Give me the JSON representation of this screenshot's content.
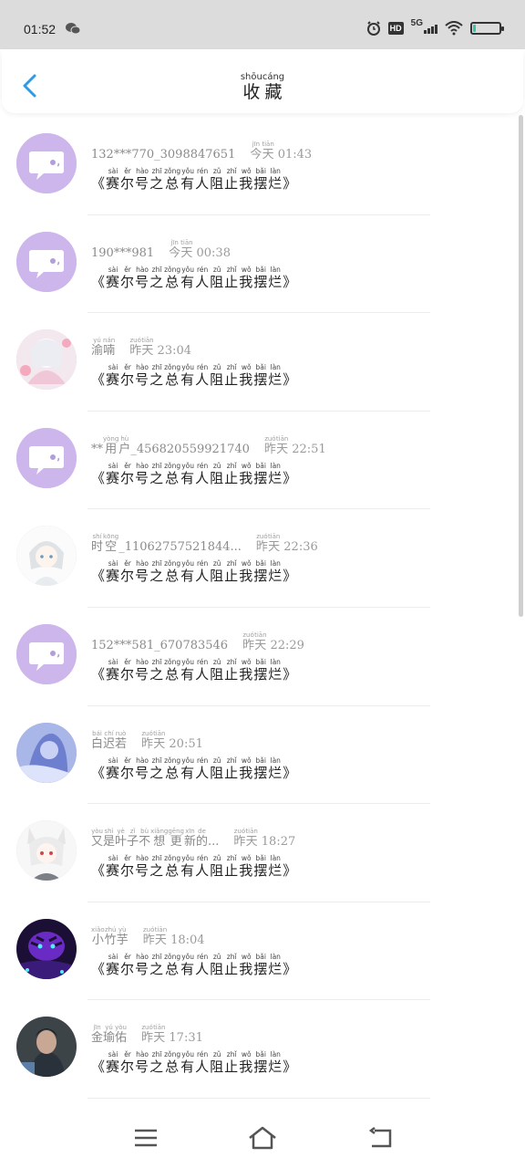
{
  "status_bar": {
    "time": "01:52",
    "hd_label": "HD",
    "network_label": "5G"
  },
  "header": {
    "title_chars": [
      {
        "char": "收",
        "pinyin": "shōu"
      },
      {
        "char": "藏",
        "pinyin": "cáng"
      }
    ]
  },
  "items": [
    {
      "avatar": "default-chat-avatar",
      "name_plain": "132***770_3098847651",
      "name_ruby": [],
      "time_ruby": [
        {
          "char": "今",
          "pinyin": "jīn"
        },
        {
          "char": "天",
          "pinyin": "tiān"
        }
      ],
      "time": "01:43"
    },
    {
      "avatar": "default-chat-avatar",
      "name_plain": "190***981",
      "name_ruby": [],
      "time_ruby": [
        {
          "char": "今",
          "pinyin": "jīn"
        },
        {
          "char": "天",
          "pinyin": "tiān"
        }
      ],
      "time": "00:38"
    },
    {
      "avatar": "anime-pink-avatar",
      "name_plain": "",
      "name_ruby": [
        {
          "char": "渝",
          "pinyin": "yú"
        },
        {
          "char": "喃",
          "pinyin": "nán"
        }
      ],
      "time_ruby": [
        {
          "char": "昨",
          "pinyin": "zuó"
        },
        {
          "char": "天",
          "pinyin": "tiān"
        }
      ],
      "time": "23:04"
    },
    {
      "avatar": "default-chat-avatar",
      "name_plain": "",
      "name_ruby": [
        {
          "char": "**",
          "pinyin": ""
        },
        {
          "char": "用",
          "pinyin": "yòng"
        },
        {
          "char": "户",
          "pinyin": "hù"
        },
        {
          "char": "_456820559921740",
          "pinyin": ""
        }
      ],
      "time_ruby": [
        {
          "char": "昨",
          "pinyin": "zuó"
        },
        {
          "char": "天",
          "pinyin": "tiān"
        }
      ],
      "time": "22:51"
    },
    {
      "avatar": "anime-white-hair-avatar",
      "name_plain": "",
      "name_ruby": [
        {
          "char": "时",
          "pinyin": "shí"
        },
        {
          "char": "空",
          "pinyin": "kōng"
        },
        {
          "char": "_11062757521844...",
          "pinyin": ""
        }
      ],
      "time_ruby": [
        {
          "char": "昨",
          "pinyin": "zuó"
        },
        {
          "char": "天",
          "pinyin": "tiān"
        }
      ],
      "time": "22:36"
    },
    {
      "avatar": "default-chat-avatar",
      "name_plain": "152***581_670783546",
      "name_ruby": [],
      "time_ruby": [
        {
          "char": "昨",
          "pinyin": "zuó"
        },
        {
          "char": "天",
          "pinyin": "tiān"
        }
      ],
      "time": "22:29"
    },
    {
      "avatar": "blue-girl-avatar",
      "name_plain": "",
      "name_ruby": [
        {
          "char": "白",
          "pinyin": "bái"
        },
        {
          "char": "迟",
          "pinyin": "chí"
        },
        {
          "char": "若",
          "pinyin": "ruò"
        }
      ],
      "time_ruby": [
        {
          "char": "昨",
          "pinyin": "zuó"
        },
        {
          "char": "天",
          "pinyin": "tiān"
        }
      ],
      "time": "20:51"
    },
    {
      "avatar": "anime-fox-avatar",
      "name_plain": "",
      "name_ruby": [
        {
          "char": "又",
          "pinyin": "yòu"
        },
        {
          "char": "是",
          "pinyin": "shì"
        },
        {
          "char": "叶",
          "pinyin": "yè"
        },
        {
          "char": "子",
          "pinyin": "zǐ"
        },
        {
          "char": "不",
          "pinyin": "bù"
        },
        {
          "char": "想",
          "pinyin": "xiǎng"
        },
        {
          "char": "更",
          "pinyin": "gēng"
        },
        {
          "char": "新",
          "pinyin": "xīn"
        },
        {
          "char": "的",
          "pinyin": "de"
        },
        {
          "char": "...",
          "pinyin": ""
        }
      ],
      "time_ruby": [
        {
          "char": "昨",
          "pinyin": "zuó"
        },
        {
          "char": "天",
          "pinyin": "tiān"
        }
      ],
      "time": "18:27"
    },
    {
      "avatar": "purple-tiger-avatar",
      "name_plain": "",
      "name_ruby": [
        {
          "char": "小",
          "pinyin": "xiǎo"
        },
        {
          "char": "竹",
          "pinyin": "zhú"
        },
        {
          "char": "芋",
          "pinyin": "yù"
        }
      ],
      "time_ruby": [
        {
          "char": "昨",
          "pinyin": "zuó"
        },
        {
          "char": "天",
          "pinyin": "tiān"
        }
      ],
      "time": "18:04"
    },
    {
      "avatar": "dark-photo-avatar",
      "name_plain": "",
      "name_ruby": [
        {
          "char": "金",
          "pinyin": "jīn"
        },
        {
          "char": "瑜",
          "pinyin": "yú"
        },
        {
          "char": "佑",
          "pinyin": "yòu"
        }
      ],
      "time_ruby": [
        {
          "char": "昨",
          "pinyin": "zuó"
        },
        {
          "char": "天",
          "pinyin": "tiān"
        }
      ],
      "time": "17:31"
    }
  ],
  "book_title": {
    "open": "《",
    "close": "》",
    "chars": [
      {
        "char": "赛",
        "pinyin": "sài"
      },
      {
        "char": "尔",
        "pinyin": "ěr"
      },
      {
        "char": "号",
        "pinyin": "hào"
      },
      {
        "char": "之",
        "pinyin": "zhī"
      },
      {
        "char": "总",
        "pinyin": "zǒng"
      },
      {
        "char": "有",
        "pinyin": "yǒu"
      },
      {
        "char": "人",
        "pinyin": "rén"
      },
      {
        "char": "阻",
        "pinyin": "zǔ"
      },
      {
        "char": "止",
        "pinyin": "zhǐ"
      },
      {
        "char": "我",
        "pinyin": "wǒ"
      },
      {
        "char": "摆",
        "pinyin": "bǎi"
      },
      {
        "char": "烂",
        "pinyin": "làn"
      }
    ]
  },
  "colors": {
    "accent_blue": "#2f9be6",
    "default_avatar_bg": "#cdb6ec",
    "status_bar_bg": "#dcdcdc"
  }
}
